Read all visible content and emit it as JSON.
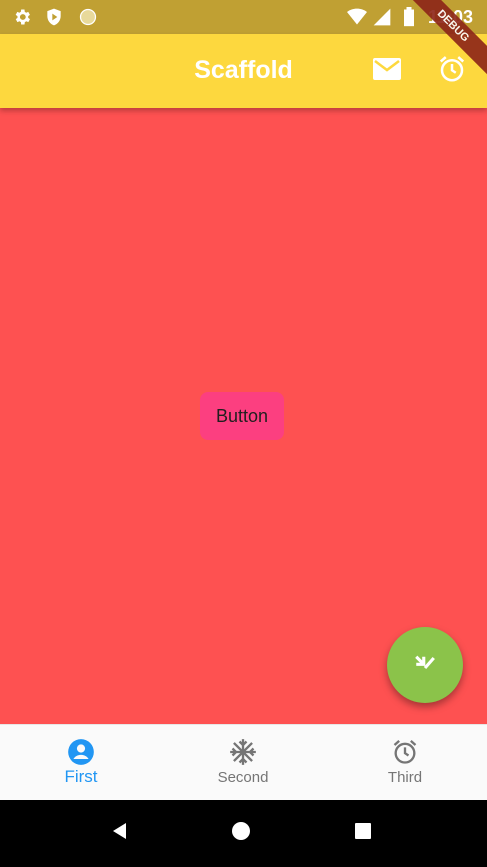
{
  "status_bar": {
    "time": "11:03",
    "icons": [
      "settings-icon",
      "shield-icon",
      "circle-icon",
      "wifi-icon",
      "signal-icon",
      "battery-icon"
    ]
  },
  "debug_banner": "DEBUG",
  "app_bar": {
    "title": "Scaffold",
    "background": "#fdd83e",
    "actions": [
      "mail-icon",
      "alarm-icon"
    ]
  },
  "body": {
    "background": "#fe5151",
    "button_label": "Button",
    "button_color": "#fc3f80"
  },
  "fab": {
    "icon": "call-received-check-icon",
    "color": "#8bc34a"
  },
  "bottom_nav": {
    "active_index": 0,
    "active_color": "#2196f3",
    "items": [
      {
        "label": "First",
        "icon": "account-circle-icon"
      },
      {
        "label": "Second",
        "icon": "snowflake-icon"
      },
      {
        "label": "Third",
        "icon": "alarm-icon"
      }
    ]
  },
  "system_nav": [
    "back-icon",
    "home-icon",
    "recents-icon"
  ]
}
